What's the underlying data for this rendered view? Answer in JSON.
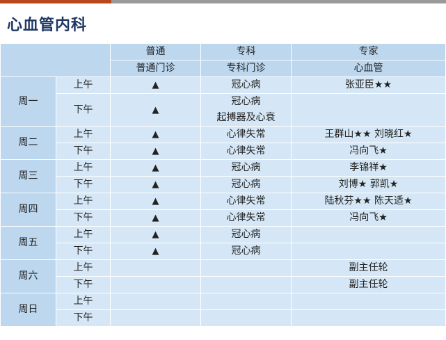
{
  "page": {
    "title": "心血管内科",
    "colors": {
      "title": "#1f3864",
      "header_bg": "#bcd7ee",
      "row_bg": "#d5e7f6",
      "accent": "#b8481d"
    }
  },
  "table": {
    "header": {
      "row1": [
        "普通",
        "专科",
        "专家"
      ],
      "row2": [
        "普通门诊",
        "专科门诊",
        "心血管"
      ]
    },
    "days": [
      {
        "day": "周一",
        "rows": [
          {
            "period": "上午",
            "general": "▲",
            "special": [
              "冠心病"
            ],
            "expert": "张亚臣★★"
          },
          {
            "period": "下午",
            "general": "▲",
            "special": [
              "冠心病",
              "起搏器及心衰"
            ],
            "expert": ""
          }
        ]
      },
      {
        "day": "周二",
        "rows": [
          {
            "period": "上午",
            "general": "▲",
            "special": [
              "心律失常"
            ],
            "expert": "王群山★★  刘晓红★"
          },
          {
            "period": "下午",
            "general": "▲",
            "special": [
              "心律失常"
            ],
            "expert": "冯向飞★"
          }
        ]
      },
      {
        "day": "周三",
        "rows": [
          {
            "period": "上午",
            "general": "▲",
            "special": [
              "冠心病"
            ],
            "expert": "李锦祥★"
          },
          {
            "period": "下午",
            "general": "▲",
            "special": [
              "冠心病"
            ],
            "expert": "刘博★ 郭凯★"
          }
        ]
      },
      {
        "day": "周四",
        "rows": [
          {
            "period": "上午",
            "general": "▲",
            "special": [
              "心律失常"
            ],
            "expert": "陆秋芬★★  陈天适★"
          },
          {
            "period": "下午",
            "general": "▲",
            "special": [
              "心律失常"
            ],
            "expert": "冯向飞★"
          }
        ]
      },
      {
        "day": "周五",
        "rows": [
          {
            "period": "上午",
            "general": "▲",
            "special": [
              "冠心病"
            ],
            "expert": ""
          },
          {
            "period": "下午",
            "general": "▲",
            "special": [
              "冠心病"
            ],
            "expert": ""
          }
        ]
      },
      {
        "day": "周六",
        "rows": [
          {
            "period": "上午",
            "general": "",
            "special": [
              ""
            ],
            "expert": "副主任轮"
          },
          {
            "period": "下午",
            "general": "",
            "special": [
              ""
            ],
            "expert": "副主任轮"
          }
        ]
      },
      {
        "day": "周日",
        "rows": [
          {
            "period": "上午",
            "general": "",
            "special": [
              ""
            ],
            "expert": ""
          },
          {
            "period": "下午",
            "general": "",
            "special": [
              ""
            ],
            "expert": ""
          }
        ]
      }
    ]
  }
}
